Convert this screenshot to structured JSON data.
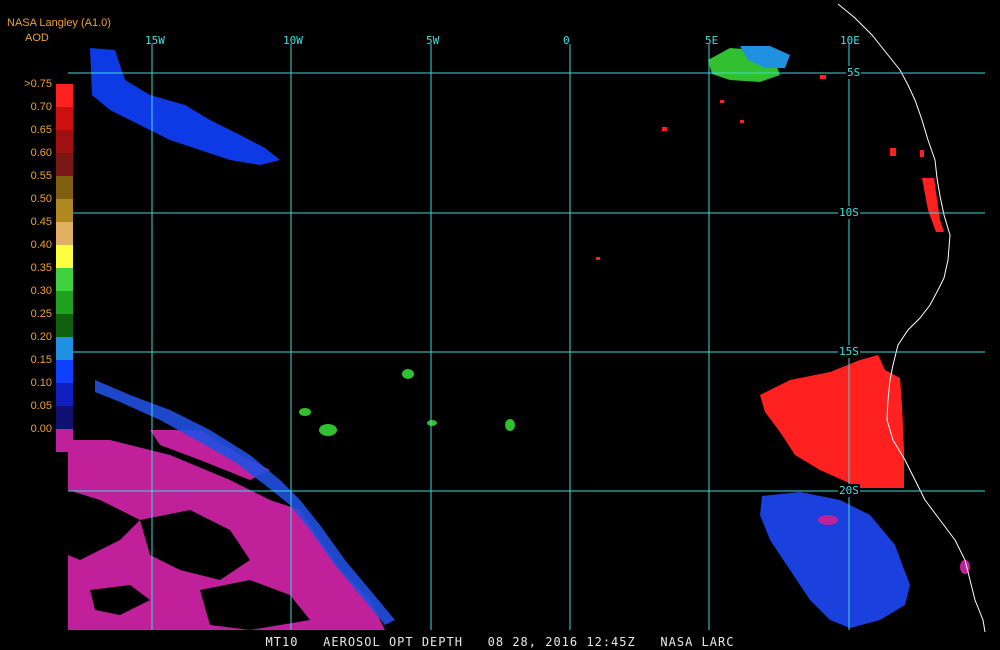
{
  "header": {
    "source": "NASA Langley (A1.0)",
    "units": "AOD"
  },
  "colorbar": {
    "labels": [
      ">0.75",
      "0.70",
      "0.65",
      "0.60",
      "0.55",
      "0.50",
      "0.45",
      "0.40",
      "0.35",
      "0.30",
      "0.25",
      "0.20",
      "0.15",
      "0.10",
      "0.05",
      "0.00"
    ],
    "colors": [
      "#ff2020",
      "#cc1010",
      "#a01010",
      "#7a1818",
      "#806010",
      "#b08820",
      "#e0b060",
      "#ffff40",
      "#40d040",
      "#20a020",
      "#106010",
      "#2090e0",
      "#1040ff",
      "#1020c0",
      "#101070",
      "#c0209a"
    ]
  },
  "grid": {
    "longitudes": [
      "15W",
      "10W",
      "5W",
      "0",
      "5E",
      "10E"
    ],
    "latitudes": [
      "5S",
      "10S",
      "15S",
      "20S"
    ]
  },
  "footer": {
    "product": "MT10",
    "title": "AEROSOL OPT DEPTH",
    "date": "08 28, 2016",
    "time": "12:45Z",
    "agency": "NASA LARC"
  }
}
